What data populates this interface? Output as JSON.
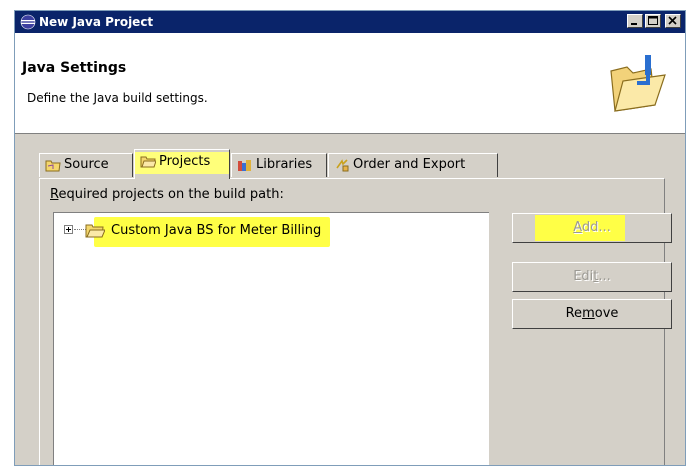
{
  "window": {
    "title": "New Java Project",
    "icon": "eclipse-icon",
    "controls": [
      "minimize",
      "maximize",
      "close"
    ]
  },
  "banner": {
    "heading": "Java Settings",
    "description": "Define the Java build settings.",
    "icon": "folder-wizard-icon"
  },
  "tabs": [
    {
      "label": "Source",
      "icon": "source-folder-icon"
    },
    {
      "label": "Projects",
      "icon": "project-folder-icon",
      "selected": true
    },
    {
      "label": "Libraries",
      "icon": "libraries-icon"
    },
    {
      "label": "Order and Export",
      "icon": "order-export-icon"
    }
  ],
  "projects_panel": {
    "label_accel": "R",
    "label_rest": "equired projects on the build path:",
    "tree_items": [
      {
        "label": "Custom Java BS for Meter Billing",
        "icon": "project-folder-icon"
      }
    ],
    "buttons": {
      "add": {
        "accel": "A",
        "rest": "dd...",
        "enabled": false
      },
      "edit": {
        "pre": "Edi",
        "accel": "t",
        "rest": "...",
        "enabled": false
      },
      "remove": {
        "pre": "Re",
        "accel": "m",
        "rest": "ove",
        "enabled": true
      }
    }
  },
  "colors": {
    "title_bar": "#0a246a",
    "highlight": "#ffff46",
    "dialog_face": "#d4d0c8"
  }
}
